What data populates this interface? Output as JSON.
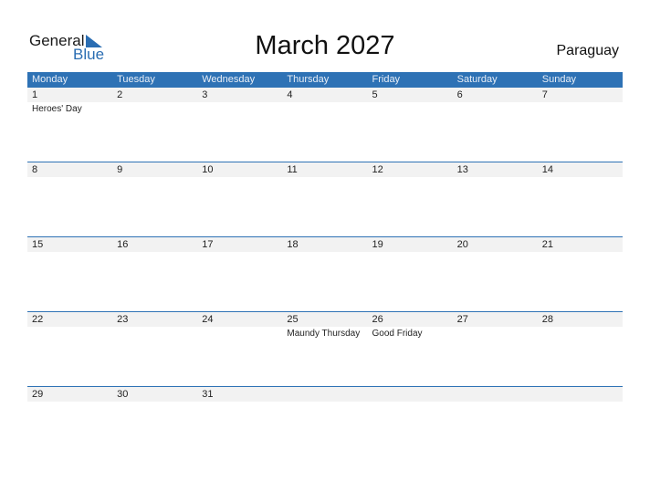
{
  "logo": {
    "text1": "General",
    "text2": "Blue"
  },
  "title": "March 2027",
  "country": "Paraguay",
  "weekdays": [
    "Monday",
    "Tuesday",
    "Wednesday",
    "Thursday",
    "Friday",
    "Saturday",
    "Sunday"
  ],
  "weeks": [
    {
      "days": [
        "1",
        "2",
        "3",
        "4",
        "5",
        "6",
        "7"
      ],
      "events": [
        "Heroes' Day",
        "",
        "",
        "",
        "",
        "",
        ""
      ]
    },
    {
      "days": [
        "8",
        "9",
        "10",
        "11",
        "12",
        "13",
        "14"
      ],
      "events": [
        "",
        "",
        "",
        "",
        "",
        "",
        ""
      ]
    },
    {
      "days": [
        "15",
        "16",
        "17",
        "18",
        "19",
        "20",
        "21"
      ],
      "events": [
        "",
        "",
        "",
        "",
        "",
        "",
        ""
      ]
    },
    {
      "days": [
        "22",
        "23",
        "24",
        "25",
        "26",
        "27",
        "28"
      ],
      "events": [
        "",
        "",
        "",
        "Maundy Thursday",
        "Good Friday",
        "",
        ""
      ]
    },
    {
      "days": [
        "29",
        "30",
        "31",
        "",
        "",
        "",
        ""
      ],
      "events": [
        "",
        "",
        "",
        "",
        "",
        "",
        ""
      ]
    }
  ],
  "colors": {
    "header": "#2e72b5",
    "strip": "#f2f2f2",
    "brand_blue": "#2a6db2"
  }
}
